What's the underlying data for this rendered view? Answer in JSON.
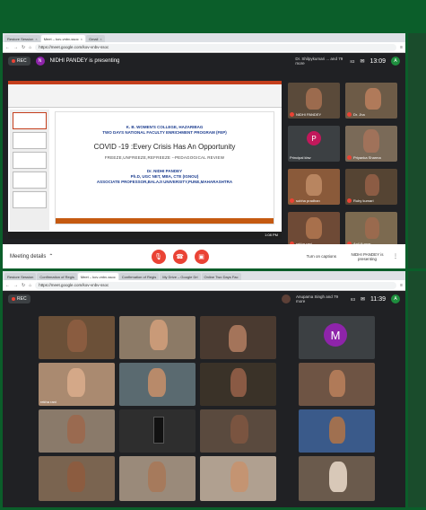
{
  "top": {
    "tabs": [
      {
        "label": "Restore Session",
        "active": false
      },
      {
        "label": "Meet – kov-vnbv-ssoc",
        "active": true
      },
      {
        "label": "Gmail",
        "active": false
      }
    ],
    "url": "https://meet.google.com/kov-vnbv-ssoc",
    "rec_label": "REC",
    "presenting_text": "NIDHI PANDEY is presenting",
    "others_text": "Dr. Shilpykumari ... and 79 more",
    "participants_count": "83",
    "time": "13:09",
    "you_initial": "A",
    "slide": {
      "line1": "K. B. WOMEN'S COLLEGE, HAZARIBAG",
      "line2": "TWO DAYS NATIONAL FACULTY ENRICHMENT PROGRAM (FEP)",
      "title": "COVID -19 :Every Crisis Has An Opportunity",
      "subtitle": "FREEZE,UNFREEZE,REFREEZE --PEDAGOGICAL REVIEW",
      "name": "Dr. NIDHI PANDEY",
      "degrees": "Ph.D, UGC NET, MBA, CTE (IGNOU)",
      "affiliation": "ASSOCIATE PROFESSOR,BALAJI UNIVERSITY,PUNE,MAHARASHTRA"
    },
    "tiles": [
      {
        "name": "NIDHI PANDEY"
      },
      {
        "name": "Dr. Jha"
      },
      {
        "name": "Principal kbw",
        "initial": "P"
      },
      {
        "name": "Priyanka Sharma"
      },
      {
        "name": "sobha pradhan"
      },
      {
        "name": "Ruby kumari"
      },
      {
        "name": "rekha rani"
      },
      {
        "name": "Anil Kumar"
      }
    ],
    "meeting_details": "Meeting details",
    "captions_label": "Turn on captions",
    "presenting_badge": "NIDHI PANDEY is presenting",
    "taskbar_time": "1:08 PM"
  },
  "bottom": {
    "tabs": [
      {
        "label": "Restore Session",
        "active": false
      },
      {
        "label": "Confirmation of Regis",
        "active": false
      },
      {
        "label": "Meet – kov-vnbv-ssoc",
        "active": true
      },
      {
        "label": "Confirmation of Regis",
        "active": false
      },
      {
        "label": "My Drive – Google Dri",
        "active": false
      },
      {
        "label": "Online Two Days Fac",
        "active": false
      }
    ],
    "url": "https://meet.google.com/kov-vnbv-ssoc",
    "rec_label": "REC",
    "others_text": "Anupama Singh and 79 more",
    "participants_count": "83",
    "time": "11:39",
    "you_initial": "A",
    "m_initial": "M",
    "rekha_label": "rekha rani"
  },
  "colors": {
    "accent_red": "#ea4335",
    "meet_bg": "#202124",
    "tile_bg": "#3c4043"
  }
}
